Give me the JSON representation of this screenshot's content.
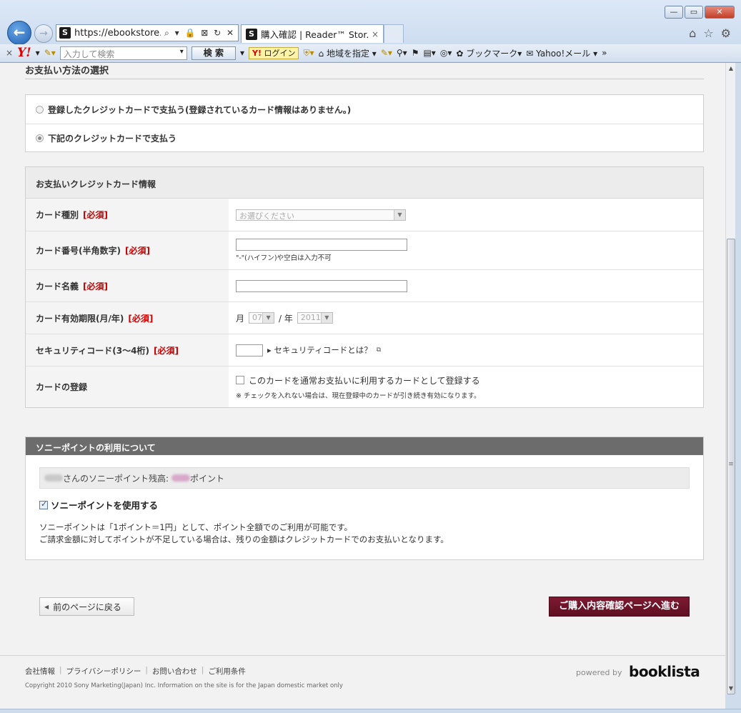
{
  "browser": {
    "address": "https://ebookstore.s.",
    "tab_title": "購入確認 | Reader™ Stor...",
    "tab_close": "×",
    "address_icons": "⌕ ▾ 🔒 ⊠ ↻ ✕",
    "toolbar_right": [
      "⌂",
      "☆",
      "⚙"
    ],
    "window_controls": [
      "—",
      "▭",
      "✕"
    ]
  },
  "yahoo_toolbar": {
    "close": "×",
    "logo": "Y!",
    "search_placeholder": "入力して検索",
    "search_button": "検 索",
    "login": "ログイン",
    "region": "地域を指定",
    "bookmark": "ブックマーク",
    "mail": "Yahoo!メール",
    "overflow": "»"
  },
  "payment_method": {
    "title": "お支払い方法の選択",
    "options": [
      {
        "label": "登録したクレジットカードで支払う(登録されているカード情報はありません。)",
        "selected": false
      },
      {
        "label": "下記のクレジットカードで支払う",
        "selected": true
      }
    ]
  },
  "card_info": {
    "title": "お支払いクレジットカード情報",
    "required": "[必須]",
    "rows": {
      "type_label": "カード種別",
      "type_placeholder": "お選びください",
      "number_label": "カード番号(半角数字)",
      "number_note": "\"-\"(ハイフン)や空白は入力不可",
      "name_label": "カード名義",
      "expiry_label": "カード有効期限(月/年)",
      "expiry_month_prefix": "月",
      "expiry_month": "07",
      "expiry_sep": "/ 年",
      "expiry_year": "2011",
      "security_label": "セキュリティコード(3〜4桁)",
      "security_link": "▸ セキュリティコードとは？",
      "register_label": "カードの登録",
      "register_checkbox": "このカードを通常お支払いに利用するカードとして登録する",
      "register_note": "※ チェックを入れない場合は、現在登録中のカードが引き続き有効になります。"
    }
  },
  "sony_points": {
    "title": "ソニーポイントの利用について",
    "balance_mid": "さんのソニーポイント残高:",
    "balance_suffix": "ポイント",
    "use_label": "ソニーポイントを使用する",
    "use_checked": true,
    "note_line1": "ソニーポイントは「1ポイント＝1円」として、ポイント全額でのご利用が可能です。",
    "note_line2": "ご請求金額に対してポイントが不足している場合は、残りの金額はクレジットカードでのお支払いとなります。"
  },
  "actions": {
    "back": "前のページに戻る",
    "next": "ご購入内容確認ページへ進む"
  },
  "footer": {
    "links": [
      "会社情報",
      "プライバシーポリシー",
      "お問い合わせ",
      "ご利用条件"
    ],
    "copyright": "Copyright 2010 Sony Marketing(Japan) Inc.  Information on the site is for the Japan domestic market only",
    "powered_by": "powered by",
    "brand": "booklista"
  },
  "colors": {
    "required": "#cc0000",
    "next_button": "#6e1428",
    "points_header": "#6c6c6c"
  }
}
